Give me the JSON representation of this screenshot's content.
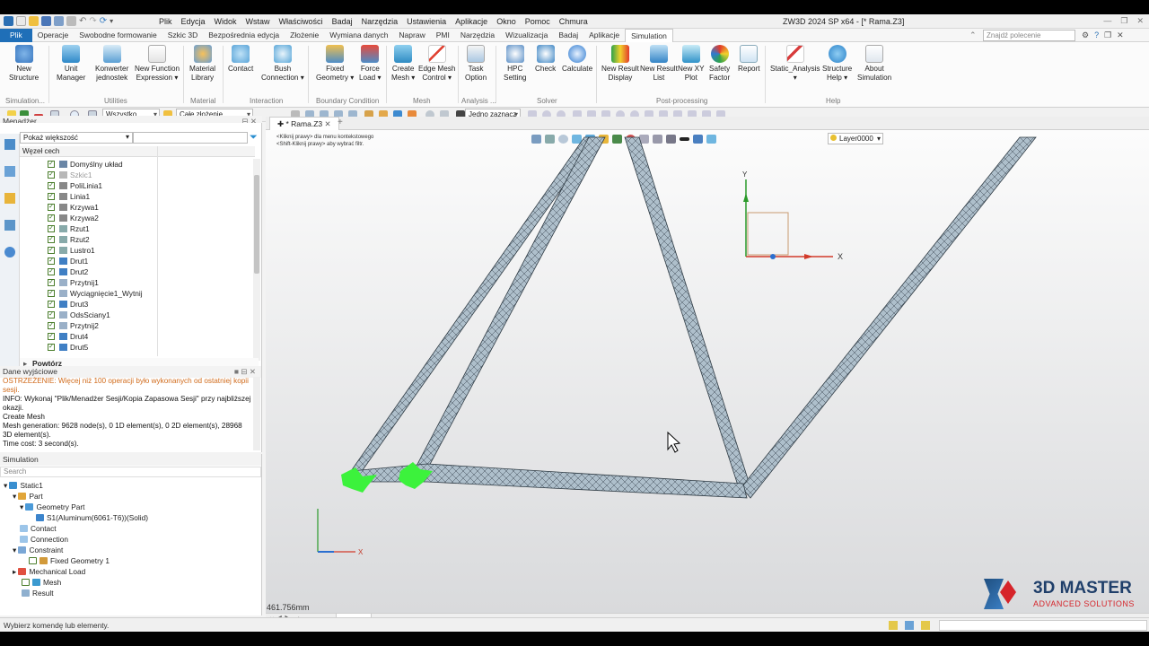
{
  "window": {
    "title": "ZW3D 2024 SP x64 - [* Rama.Z3]"
  },
  "menubar": [
    "Plik",
    "Edycja",
    "Widok",
    "Wstaw",
    "Właściwości",
    "Badaj",
    "Narzędzia",
    "Ustawienia",
    "Aplikacje",
    "Okno",
    "Pomoc",
    "Chmura"
  ],
  "ribbon_tabs": [
    "Plik",
    "Operacje",
    "Swobodne formowanie",
    "Szkic 3D",
    "Bezpośrednia edycja",
    "Złożenie",
    "Wymiana danych",
    "Napraw",
    "PMI",
    "Narzędzia",
    "Wizualizacja",
    "Badaj",
    "Aplikacje",
    "Simulation"
  ],
  "search_placeholder": "Znajdź polecenie",
  "ribbon": {
    "new_structure": "New\nStructure",
    "unit_manager": "Unit\nManager",
    "konwerter": "Konwerter\njednostek",
    "new_function": "New Function\nExpression ▾",
    "material_library": "Material\nLibrary",
    "contact": "Contact",
    "bush": "Bush\nConnection ▾",
    "fixed": "Fixed\nGeometry ▾",
    "force": "Force\nLoad ▾",
    "create_mesh": "Create\nMesh ▾",
    "edge_mesh": "Edge Mesh\nControl ▾",
    "task_option": "Task\nOption",
    "hpc": "HPC\nSetting",
    "check": "Check",
    "calculate": "Calculate",
    "new_result_display": "New Result\nDisplay",
    "new_result_list": "New Result\nList",
    "new_xy": "New XY\nPlot",
    "safety": "Safety\nFactor",
    "report": "Report",
    "static_analysis": "Static_Analysis\n▾",
    "structure_help": "Structure\nHelp ▾",
    "about": "About\nSimulation",
    "groups": {
      "simulation": "Simulation...",
      "utilities": "Utilities",
      "material": "Material",
      "interaction": "Interaction",
      "boundary": "Boundary Condition",
      "mesh": "Mesh",
      "analysis": "Analysis ...",
      "solver": "Solver",
      "post": "Post-processing",
      "help": "Help"
    }
  },
  "toolbar": {
    "filter": "Wszystko",
    "scope": "Całe złożenie",
    "select": "Jedno zaznacz"
  },
  "manager": {
    "title": "Menadżer",
    "filter": "Pokaż większość",
    "column": "Węzeł cech",
    "items": [
      "Domyślny układ",
      "Szkic1",
      "PoliLinia1",
      "Linia1",
      "Krzywa1",
      "Krzywa2",
      "Rzut1",
      "Rzut2",
      "Lustro1",
      "Drut1",
      "Drut2",
      "Przytnij1",
      "Wyciągnięcie1_Wytnij",
      "Drut3",
      "OdsSciany1",
      "Przytnij2",
      "Drut4",
      "Drut5"
    ],
    "repeat": "Powtórz"
  },
  "output": {
    "title": "Dane wyjściowe",
    "warning": "OSTRZEŻENIE: Więcej niż 100 operacji było wykonanych od ostatniej kopii sesji.",
    "info": "INFO: Wykonaj \"Plik/Menadżer Sesji/Kopia Zapasowa Sesji\" przy najbliższej okazji.",
    "l1": "Create Mesh",
    "l2": "Mesh generation: 9628 node(s), 0 1D element(s), 0 2D element(s), 28968 3D element(s).",
    "l3": "Time cost: 3 second(s)."
  },
  "simulation": {
    "title": "Simulation",
    "search": "Search",
    "static": "Static1",
    "part": "Part",
    "geometry": "Geometry Part",
    "solid": "S1(Aluminum(6061-T6))(Solid)",
    "contact": "Contact",
    "connection": "Connection",
    "constraint": "Constraint",
    "fixed": "Fixed Geometry 1",
    "mech": "Mechanical Load",
    "mesh": "Mesh",
    "result": "Result"
  },
  "viewport": {
    "doc_tab": "* Rama.Z3",
    "hint1": "<Kliknij prawy> dla menu kontekstowego",
    "hint2": "<Shift-Kliknij prawy> aby wybrać filtr.",
    "layer": "Layer0000",
    "scale": "461.756mm",
    "axis_x": "X",
    "axis_y": "Y"
  },
  "logo": {
    "brand": "3D MASTER",
    "sub": "ADVANCED SOLUTIONS"
  },
  "bottom_tabs": [
    "Model",
    "Static1"
  ],
  "status": "Wybierz komendę lub elementy."
}
